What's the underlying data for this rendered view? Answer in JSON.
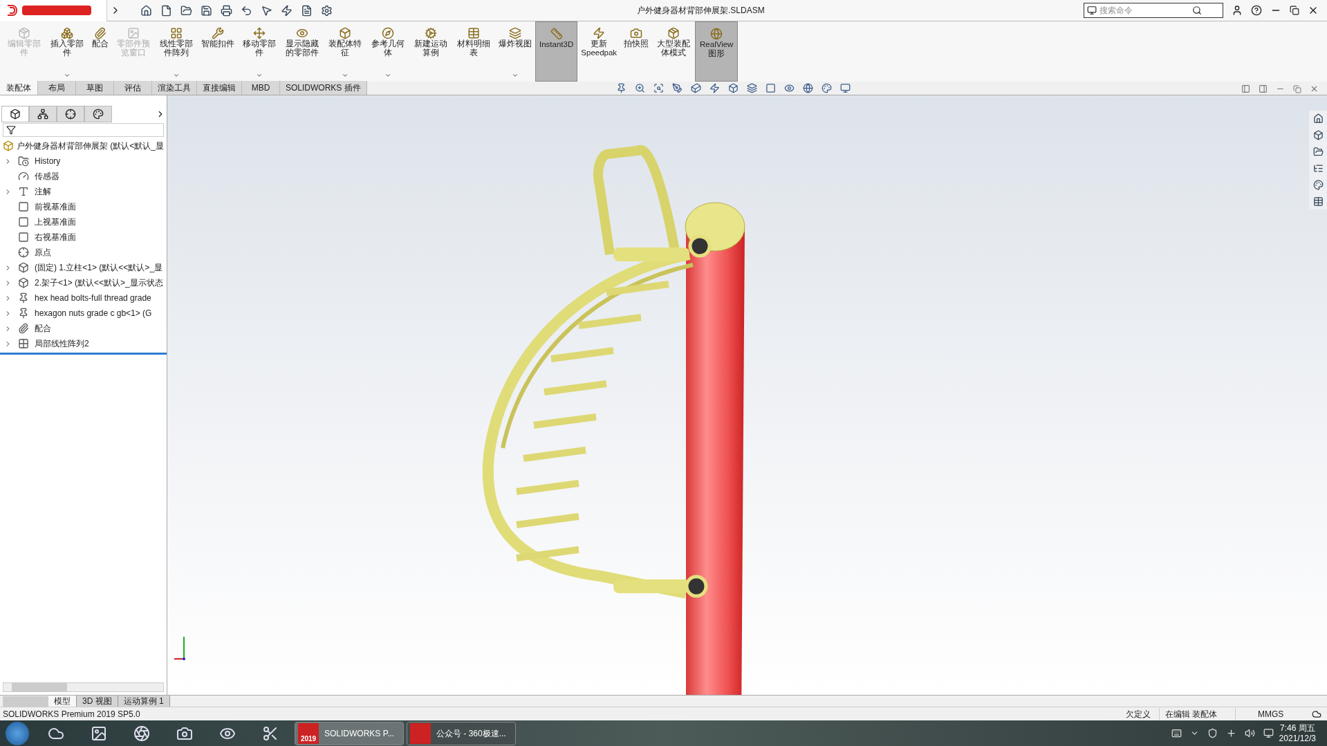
{
  "window": {
    "title": "户外健身器材背部伸展架.SLDASM",
    "search": {
      "placeholder": "搜索命令"
    }
  },
  "ribbon": [
    {
      "label": "编辑零部件",
      "disabled": true,
      "selected": false,
      "menu": false
    },
    {
      "label": "插入零部件",
      "disabled": false,
      "selected": false,
      "menu": true
    },
    {
      "label": "配合",
      "disabled": false,
      "selected": false,
      "menu": false
    },
    {
      "label": "零部件预览窗口",
      "disabled": true,
      "selected": false,
      "menu": false
    },
    {
      "label": "线性零部件阵列",
      "disabled": false,
      "selected": false,
      "menu": true
    },
    {
      "label": "智能扣件",
      "disabled": false,
      "selected": false,
      "menu": false
    },
    {
      "label": "移动零部件",
      "disabled": false,
      "selected": false,
      "menu": true
    },
    {
      "label": "显示隐藏的零部件",
      "disabled": false,
      "selected": false,
      "menu": false
    },
    {
      "label": "装配体特征",
      "disabled": false,
      "selected": false,
      "menu": true
    },
    {
      "label": "参考几何体",
      "disabled": false,
      "selected": false,
      "menu": true
    },
    {
      "label": "新建运动算例",
      "disabled": false,
      "selected": false,
      "menu": false
    },
    {
      "label": "材料明细表",
      "disabled": false,
      "selected": false,
      "menu": false
    },
    {
      "label": "爆炸视图",
      "disabled": false,
      "selected": false,
      "menu": true
    },
    {
      "label": "Instant3D",
      "disabled": false,
      "selected": true,
      "menu": false
    },
    {
      "label": "更新Speedpak",
      "disabled": false,
      "selected": false,
      "menu": false
    },
    {
      "label": "拍快照",
      "disabled": false,
      "selected": false,
      "menu": false
    },
    {
      "label": "大型装配体模式",
      "disabled": false,
      "selected": false,
      "menu": false
    },
    {
      "label": "RealView图形",
      "disabled": false,
      "selected": true,
      "menu": false
    }
  ],
  "command_tabs": [
    {
      "label": "装配体",
      "selected": true
    },
    {
      "label": "布局",
      "selected": false
    },
    {
      "label": "草图",
      "selected": false
    },
    {
      "label": "评估",
      "selected": false
    },
    {
      "label": "渲染工具",
      "selected": false
    },
    {
      "label": "直接编辑",
      "selected": false
    },
    {
      "label": "MBD",
      "selected": false
    },
    {
      "label": "SOLIDWORKS 插件",
      "selected": false
    }
  ],
  "panel_tabs": [
    {
      "selected": true
    },
    {
      "selected": false
    },
    {
      "selected": false
    },
    {
      "selected": false
    }
  ],
  "tree": {
    "root": "户外健身器材背部伸展架  (默认<默认_显",
    "items": [
      {
        "kind": "history",
        "label": "History",
        "expandable": true
      },
      {
        "kind": "sensor",
        "label": "传感器",
        "expandable": false
      },
      {
        "kind": "annotation",
        "label": "注解",
        "expandable": true
      },
      {
        "kind": "plane",
        "label": "前视基准面",
        "expandable": false
      },
      {
        "kind": "plane",
        "label": "上视基准面",
        "expandable": false
      },
      {
        "kind": "plane",
        "label": "右视基准面",
        "expandable": false
      },
      {
        "kind": "origin",
        "label": "原点",
        "expandable": false
      },
      {
        "kind": "part",
        "label": "(固定) 1.立柱<1> (默认<<默认>_显",
        "expandable": true
      },
      {
        "kind": "part",
        "label": "2.架子<1> (默认<<默认>_显示状态",
        "expandable": true
      },
      {
        "kind": "bolt",
        "label": "hex head bolts-full thread grade",
        "expandable": true
      },
      {
        "kind": "bolt",
        "label": "hexagon nuts grade c gb<1> (G",
        "expandable": true
      },
      {
        "kind": "mate",
        "label": "配合",
        "expandable": true
      },
      {
        "kind": "pattern",
        "label": "局部线性阵列2",
        "expandable": true
      }
    ]
  },
  "bottom_tabs": [
    {
      "label": "模型",
      "selected": true
    },
    {
      "label": "3D 视图",
      "selected": false
    },
    {
      "label": "运动算例 1",
      "selected": false
    }
  ],
  "status_bar": {
    "product": "SOLIDWORKS Premium 2019 SP5.0",
    "state": "欠定义",
    "mode": "在编辑 装配体",
    "units": "MMGS"
  },
  "taskbar": {
    "windows": [
      {
        "label": "SOLIDWORKS P...",
        "badge": "2019",
        "selected": true
      },
      {
        "label": "公众号 - 360极速...",
        "selected": false
      }
    ],
    "time": "7:46 周五",
    "date": "2021/12/3"
  }
}
